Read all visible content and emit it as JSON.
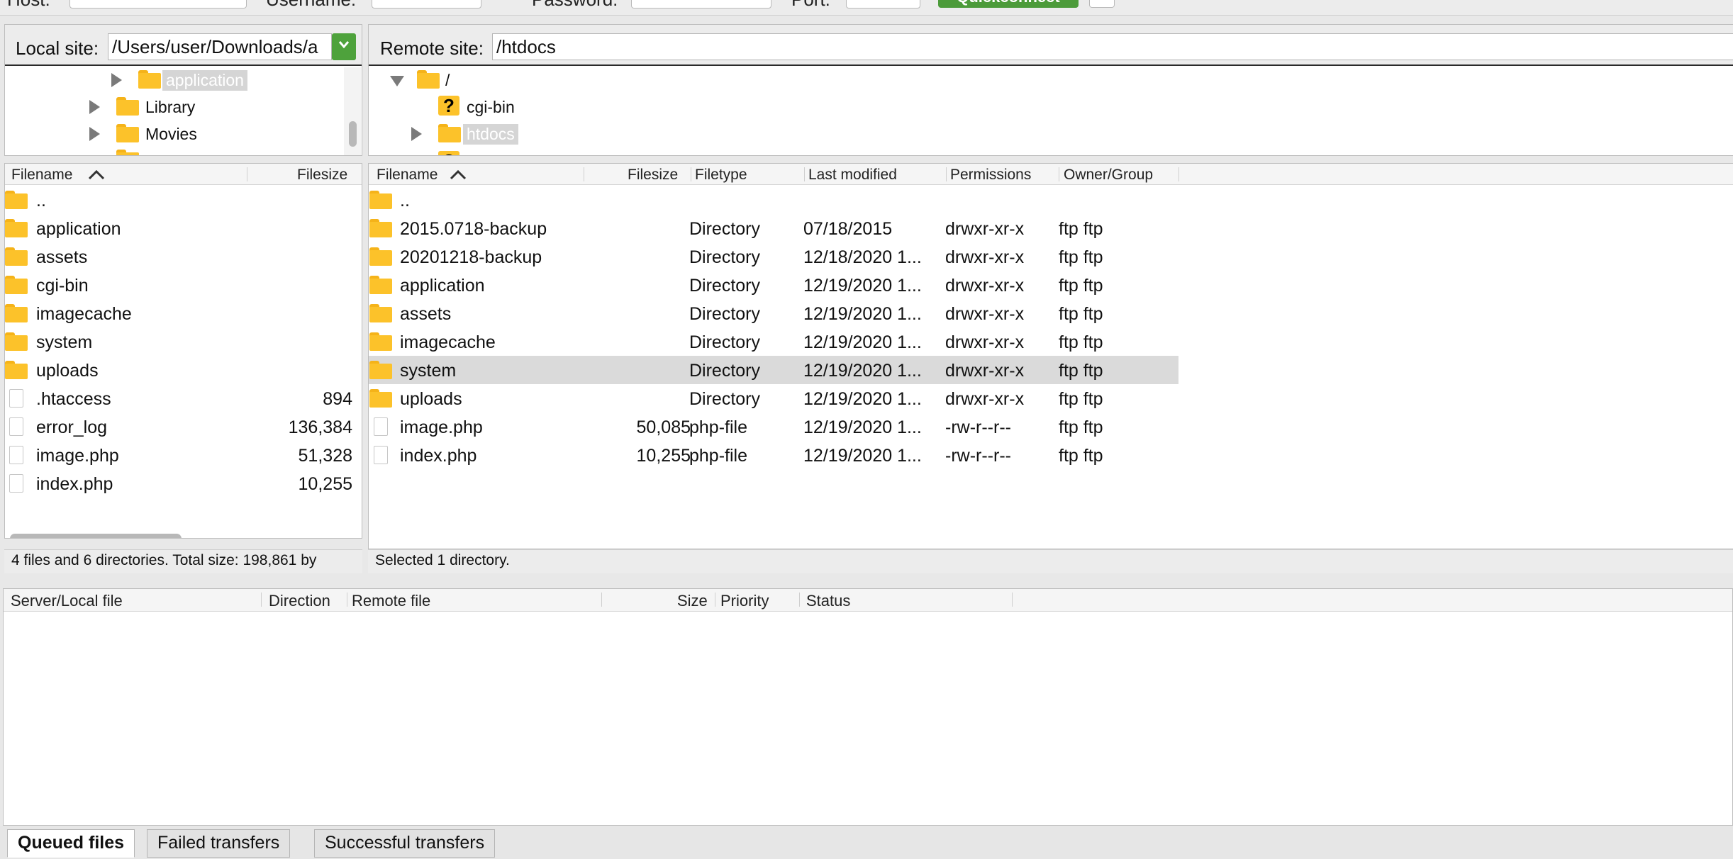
{
  "quickconnect": {
    "host_label": "Host:",
    "username_label": "Username:",
    "password_label": "Password:",
    "port_label": "Port:",
    "connect_label": "Quickconnect",
    "accent_color": "#4c9b3a"
  },
  "local": {
    "site_label": "Local site:",
    "path": "/Users/user/Downloads/a",
    "tree": [
      {
        "label": "application",
        "expander": "collapsed",
        "selected": true
      },
      {
        "label": "Library",
        "expander": "collapsed",
        "selected": false
      },
      {
        "label": "Movies",
        "expander": "collapsed",
        "selected": false
      }
    ],
    "columns": {
      "filename": "Filename",
      "filesize": "Filesize"
    },
    "files": [
      {
        "name": "..",
        "type": "folder",
        "size": ""
      },
      {
        "name": "application",
        "type": "folder",
        "size": ""
      },
      {
        "name": "assets",
        "type": "folder",
        "size": ""
      },
      {
        "name": "cgi-bin",
        "type": "folder",
        "size": ""
      },
      {
        "name": "imagecache",
        "type": "folder",
        "size": ""
      },
      {
        "name": "system",
        "type": "folder",
        "size": ""
      },
      {
        "name": "uploads",
        "type": "folder",
        "size": ""
      },
      {
        "name": ".htaccess",
        "type": "file",
        "size": "894"
      },
      {
        "name": "error_log",
        "type": "file",
        "size": "136,384"
      },
      {
        "name": "image.php",
        "type": "file",
        "size": "51,328"
      },
      {
        "name": "index.php",
        "type": "file",
        "size": "10,255"
      }
    ],
    "status": "4 files and 6 directories. Total size: 198,861 by"
  },
  "remote": {
    "site_label": "Remote site:",
    "path": "/htdocs",
    "tree": [
      {
        "label": "/",
        "expander": "expanded",
        "icon": "folder",
        "selected": false
      },
      {
        "label": "cgi-bin",
        "expander": "none",
        "icon": "unknown",
        "selected": false
      },
      {
        "label": "htdocs",
        "expander": "collapsed",
        "icon": "folder",
        "selected": true
      }
    ],
    "columns": {
      "filename": "Filename",
      "filesize": "Filesize",
      "filetype": "Filetype",
      "last_modified": "Last modified",
      "permissions": "Permissions",
      "owner_group": "Owner/Group"
    },
    "files": [
      {
        "name": "..",
        "type": "folder",
        "size": "",
        "filetype": "",
        "modified": "",
        "perms": "",
        "owner": "",
        "selected": false
      },
      {
        "name": "2015.0718-backup",
        "type": "folder",
        "size": "",
        "filetype": "Directory",
        "modified": "07/18/2015",
        "perms": "drwxr-xr-x",
        "owner": "ftp ftp",
        "selected": false
      },
      {
        "name": "20201218-backup",
        "type": "folder",
        "size": "",
        "filetype": "Directory",
        "modified": "12/18/2020 1...",
        "perms": "drwxr-xr-x",
        "owner": "ftp ftp",
        "selected": false
      },
      {
        "name": "application",
        "type": "folder",
        "size": "",
        "filetype": "Directory",
        "modified": "12/19/2020 1...",
        "perms": "drwxr-xr-x",
        "owner": "ftp ftp",
        "selected": false
      },
      {
        "name": "assets",
        "type": "folder",
        "size": "",
        "filetype": "Directory",
        "modified": "12/19/2020 1...",
        "perms": "drwxr-xr-x",
        "owner": "ftp ftp",
        "selected": false
      },
      {
        "name": "imagecache",
        "type": "folder",
        "size": "",
        "filetype": "Directory",
        "modified": "12/19/2020 1...",
        "perms": "drwxr-xr-x",
        "owner": "ftp ftp",
        "selected": false
      },
      {
        "name": "system",
        "type": "folder",
        "size": "",
        "filetype": "Directory",
        "modified": "12/19/2020 1...",
        "perms": "drwxr-xr-x",
        "owner": "ftp ftp",
        "selected": true
      },
      {
        "name": "uploads",
        "type": "folder",
        "size": "",
        "filetype": "Directory",
        "modified": "12/19/2020 1...",
        "perms": "drwxr-xr-x",
        "owner": "ftp ftp",
        "selected": false
      },
      {
        "name": "image.php",
        "type": "file",
        "size": "50,085",
        "filetype": "php-file",
        "modified": "12/19/2020 1...",
        "perms": "-rw-r--r--",
        "owner": "ftp ftp",
        "selected": false
      },
      {
        "name": "index.php",
        "type": "file",
        "size": "10,255",
        "filetype": "php-file",
        "modified": "12/19/2020 1...",
        "perms": "-rw-r--r--",
        "owner": "ftp ftp",
        "selected": false
      }
    ],
    "status": "Selected 1 directory."
  },
  "queue": {
    "columns": {
      "server_local": "Server/Local file",
      "direction": "Direction",
      "remote_file": "Remote file",
      "size": "Size",
      "priority": "Priority",
      "status": "Status"
    }
  },
  "tabs": [
    {
      "label": "Queued files",
      "active": true
    },
    {
      "label": "Failed transfers",
      "active": false
    },
    {
      "label": "Successful transfers",
      "active": false
    }
  ],
  "colors": {
    "folder": "#fcc22a",
    "selection": "#dadada",
    "dropdown_green": "#4ea23c"
  }
}
